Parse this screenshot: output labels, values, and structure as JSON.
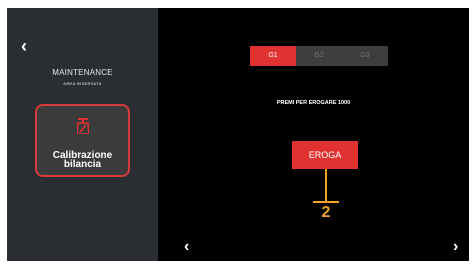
{
  "sidebar": {
    "back_icon": "‹",
    "title": "MAINTENANCE",
    "subtitle": "AREA RISERVATA",
    "tile": {
      "icon": "scale-icon",
      "label": "Calibrazione bilancia"
    },
    "accent": "#d63a3a"
  },
  "main": {
    "tabs": [
      {
        "label": "G1",
        "active": true
      },
      {
        "label": "G2",
        "active": false
      },
      {
        "label": "G3",
        "active": false
      }
    ],
    "instruction": "PREMI PER EROGARE 1000",
    "dispense_label": "EROGA",
    "callout_number": "2",
    "prev_icon": "‹",
    "next_icon": "›",
    "accent": "#e13232",
    "callout_color": "#f0a52a"
  }
}
